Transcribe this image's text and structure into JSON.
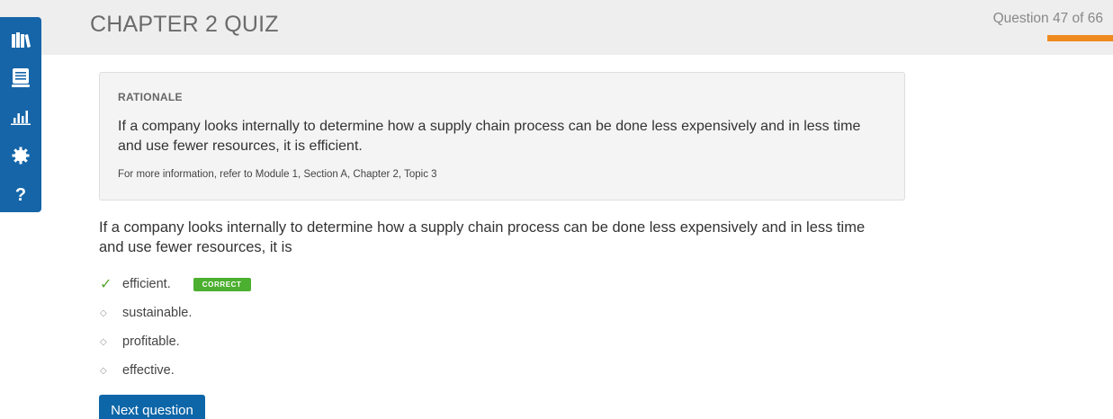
{
  "header": {
    "title": "CHAPTER 2 QUIZ",
    "progress_text": "Question 47 of 66",
    "progress_current": 47,
    "progress_total": 66
  },
  "sidebar": {
    "items": [
      {
        "name": "library-icon"
      },
      {
        "name": "notebook-icon"
      },
      {
        "name": "bar-chart-icon"
      },
      {
        "name": "gear-icon"
      },
      {
        "name": "help-icon"
      }
    ]
  },
  "rationale": {
    "heading": "RATIONALE",
    "text": "If a company looks internally to determine how a supply chain process can be done less expensively and in less time and use fewer resources, it is efficient.",
    "reference": "For more information, refer to Module 1, Section A, Chapter 2, Topic 3"
  },
  "question": {
    "text": "If a company looks internally to determine how a supply chain process can be done less expensively and in less time and use fewer resources, it is"
  },
  "answers": [
    {
      "label": "efficient.",
      "correct": true,
      "badge": "CORRECT"
    },
    {
      "label": "sustainable.",
      "correct": false
    },
    {
      "label": "profitable.",
      "correct": false
    },
    {
      "label": "effective.",
      "correct": false
    }
  ],
  "next_button": {
    "label": "Next question"
  },
  "colors": {
    "header_bg": "#eeeeee",
    "sidebar_bg": "#1565a8",
    "progress": "#ef8a1f",
    "correct": "#4caf2f",
    "button": "#0d66a8"
  }
}
